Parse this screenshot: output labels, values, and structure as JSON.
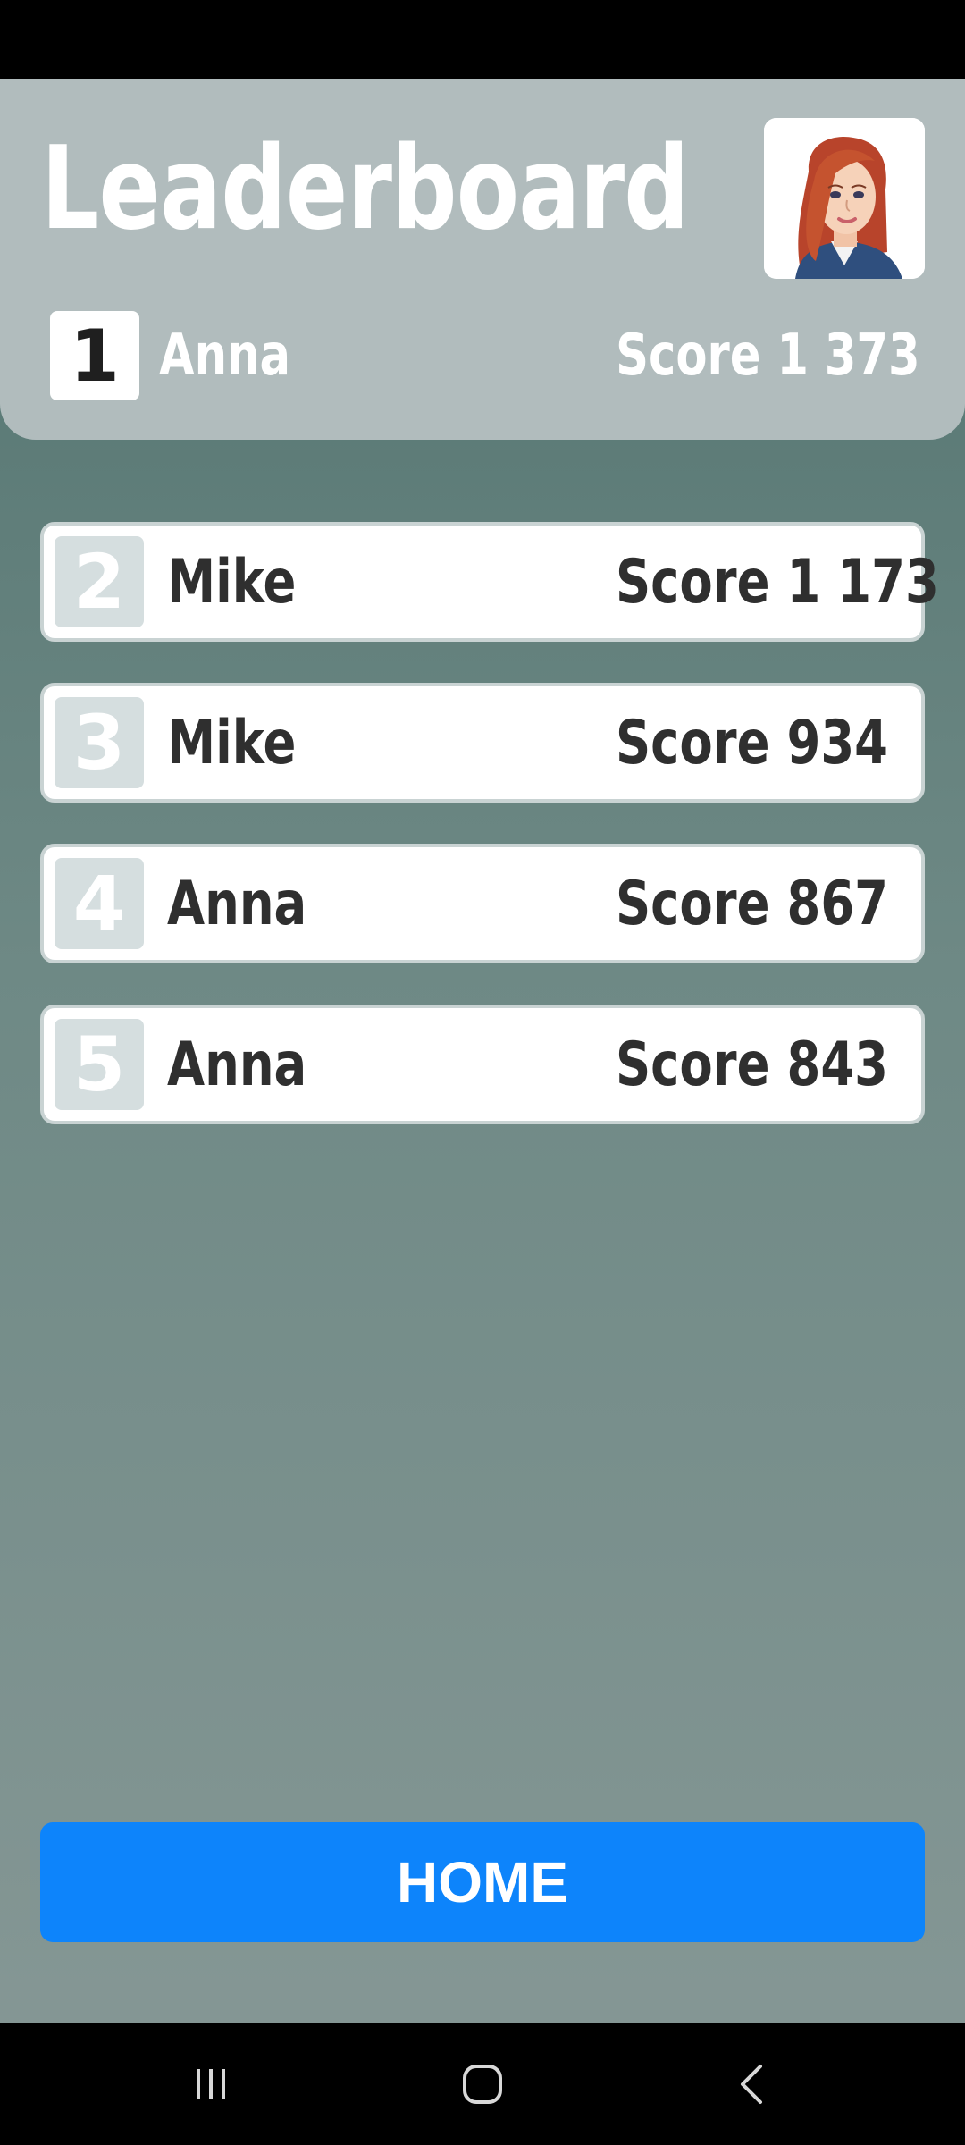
{
  "header": {
    "title": "Leaderboard",
    "top_player": {
      "rank": "1",
      "name": "Anna",
      "score": "Score 1 373"
    }
  },
  "entries": [
    {
      "rank": "2",
      "name": "Mike",
      "score": "Score 1 173"
    },
    {
      "rank": "3",
      "name": "Mike",
      "score": "Score 934"
    },
    {
      "rank": "4",
      "name": "Anna",
      "score": "Score 867"
    },
    {
      "rank": "5",
      "name": "Anna",
      "score": "Score 843"
    }
  ],
  "home_button": {
    "label": "HOME"
  },
  "icons": {
    "avatar": "avatar-icon",
    "nav_recents": "recent-apps-icon",
    "nav_home": "home-circle-icon",
    "nav_back": "back-chevron-icon"
  },
  "colors": {
    "header_bg": "#b1bcbd",
    "button_blue": "#0d84fb",
    "row_rank_bg": "#d5dedf"
  }
}
